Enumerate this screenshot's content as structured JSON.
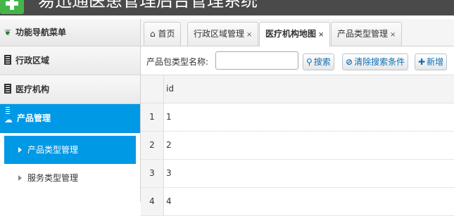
{
  "app": {
    "title": "易迅通医患管理后台管理系统"
  },
  "sidebar": {
    "header": "功能导航菜单",
    "menus": [
      {
        "label": "行政区域"
      },
      {
        "label": "医疗机构"
      },
      {
        "label": "产品管理"
      }
    ],
    "submenu": [
      {
        "label": "产品类型管理"
      },
      {
        "label": "服务类型管理"
      }
    ]
  },
  "tabs": [
    {
      "label": "首页",
      "icon": "home-icon"
    },
    {
      "label": "行政区域管理",
      "close": "×"
    },
    {
      "label": "医疗机构地图",
      "close": "×"
    },
    {
      "label": "产品类型管理",
      "close": "×"
    }
  ],
  "toolbar": {
    "label": "产品包类型名称:",
    "search_value": "",
    "search_button": "搜索",
    "clear_button": "清除搜索条件",
    "add_button": "新增"
  },
  "grid": {
    "header": "id",
    "rows": [
      {
        "num": "1",
        "id": "1"
      },
      {
        "num": "2",
        "id": "2"
      },
      {
        "num": "3",
        "id": "3"
      },
      {
        "num": "4",
        "id": "4"
      }
    ]
  }
}
